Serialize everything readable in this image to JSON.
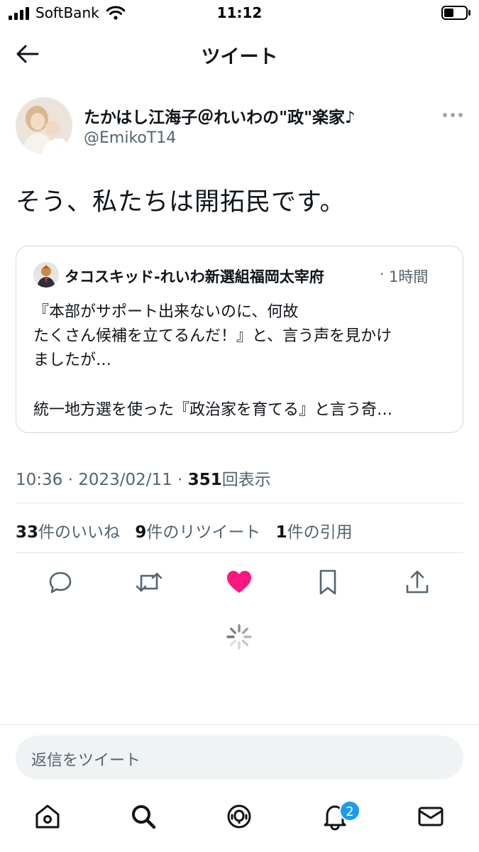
{
  "status_bar": {
    "carrier": "SoftBank",
    "time": "11:12"
  },
  "header": {
    "title": "ツイート"
  },
  "tweet": {
    "author_name": "たかはし江海子＠れいわの\"政\"楽家♪",
    "author_handle": "@EmikoT14",
    "text": "そう、私たちは開拓民です。",
    "time": "10:36",
    "date": "2023/02/11",
    "views": "351",
    "views_label": "回表示",
    "likes": "33",
    "likes_label": "件のいいね",
    "retweets": "9",
    "retweets_label": "件のリツイート",
    "quotes": "1",
    "quotes_label": "件の引用",
    "liked": true
  },
  "quoted_tweet": {
    "author_name": "タコスキッド-れいわ新選組福岡太宰府",
    "time": "1時間",
    "lines": [
      "『本部がサポート出来ないのに、何故",
      "たくさん候補を立てるんだ！』と、言う声を見かけ",
      "ましたが…",
      "統一地方選を使った『政治家を育てる』と言う奇…"
    ]
  },
  "reply": {
    "placeholder": "返信をツイート"
  },
  "tabbar": {
    "notification_count": "2"
  },
  "colors": {
    "like": "#f91880",
    "accent": "#1d9bf0",
    "muted": "#536471",
    "icon": "#0f1419"
  }
}
